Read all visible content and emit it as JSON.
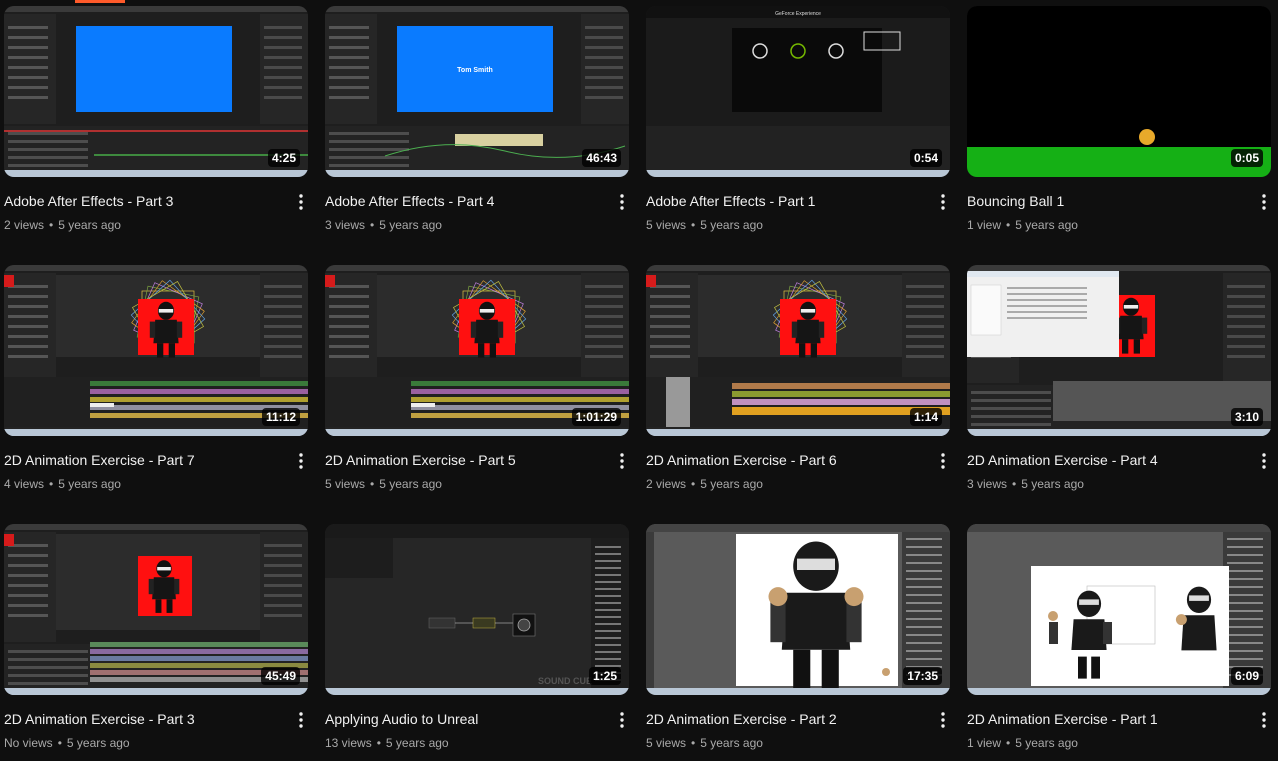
{
  "colors": {
    "background": "#0f0f0f",
    "title": "#f1f1f1",
    "meta": "#aaaaaa",
    "accent": "#ff5a2a"
  },
  "videos": [
    {
      "title": "Adobe After Effects - Part 3",
      "views": "2 views",
      "age": "5 years ago",
      "duration": "4:25",
      "thumb": "ae-blue"
    },
    {
      "title": "Adobe After Effects - Part 4",
      "views": "3 views",
      "age": "5 years ago",
      "duration": "46:43",
      "thumb": "ae-blue-text",
      "thumb_text": [
        "Tom Smith"
      ]
    },
    {
      "title": "Adobe After Effects - Part 1",
      "views": "5 views",
      "age": "5 years ago",
      "duration": "0:54",
      "thumb": "geforce",
      "thumb_text": [
        "GeForce Experience"
      ]
    },
    {
      "title": "Bouncing Ball 1",
      "views": "1 view",
      "age": "5 years ago",
      "duration": "0:05",
      "thumb": "ball"
    },
    {
      "title": "2D Animation Exercise - Part 7",
      "views": "4 views",
      "age": "5 years ago",
      "duration": "11:12",
      "thumb": "ninja-ae"
    },
    {
      "title": "2D Animation Exercise - Part 5",
      "views": "5 views",
      "age": "5 years ago",
      "duration": "1:01:29",
      "thumb": "ninja-ae"
    },
    {
      "title": "2D Animation Exercise - Part 6",
      "views": "2 views",
      "age": "5 years ago",
      "duration": "1:14",
      "thumb": "ninja-ae-orange"
    },
    {
      "title": "2D Animation Exercise - Part 4",
      "views": "3 views",
      "age": "5 years ago",
      "duration": "3:10",
      "thumb": "ninja-dialog"
    },
    {
      "title": "2D Animation Exercise - Part 3",
      "views": "No views",
      "age": "5 years ago",
      "duration": "45:49",
      "thumb": "ninja-ae-small"
    },
    {
      "title": "Applying Audio to Unreal",
      "views": "13 views",
      "age": "5 years ago",
      "duration": "1:25",
      "thumb": "unreal",
      "thumb_text": [
        "SOUND CUE"
      ]
    },
    {
      "title": "2D Animation Exercise - Part 2",
      "views": "5 views",
      "age": "5 years ago",
      "duration": "17:35",
      "thumb": "ninja-ps"
    },
    {
      "title": "2D Animation Exercise - Part 1",
      "views": "1 view",
      "age": "5 years ago",
      "duration": "6:09",
      "thumb": "ninja-ps-parts"
    }
  ]
}
